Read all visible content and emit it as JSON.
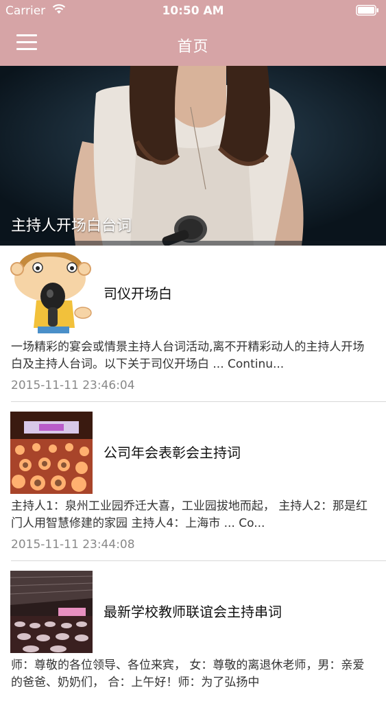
{
  "status_bar": {
    "carrier": "Carrier",
    "time": "10:50 AM"
  },
  "navbar": {
    "title": "首页",
    "menu_icon": "hamburger-menu-icon",
    "background": "#d6a4a6"
  },
  "hero": {
    "caption": "主持人开场白台词"
  },
  "articles": [
    {
      "title": "司仪开场白",
      "summary": "  一场精彩的宴会或情景主持人台词活动,离不开精彩动人的主持人开场白及主持人台词。以下关于司仪开场白 ... Continu...",
      "date": "2015-11-11 23:46:04",
      "thumb": "cartoon-host-with-microphone"
    },
    {
      "title": "公司年会表彰会主持词",
      "summary": "     主持人1：泉州工业园乔迁大喜，工业园拔地而起， 主持人2：那是红门人用智慧修建的家园 主持人4：上海市 ... Co...",
      "date": "2015-11-11 23:44:08",
      "thumb": "banquet-hall-photo"
    },
    {
      "title": "最新学校教师联谊会主持串词",
      "summary": "师：尊敬的各位领导、各位来宾， 女：尊敬的离退休老师，男：亲爱的爸爸、奶奶们， 合：上午好！师：为了弘扬中",
      "date": "",
      "thumb": "event-hall-photo"
    }
  ]
}
